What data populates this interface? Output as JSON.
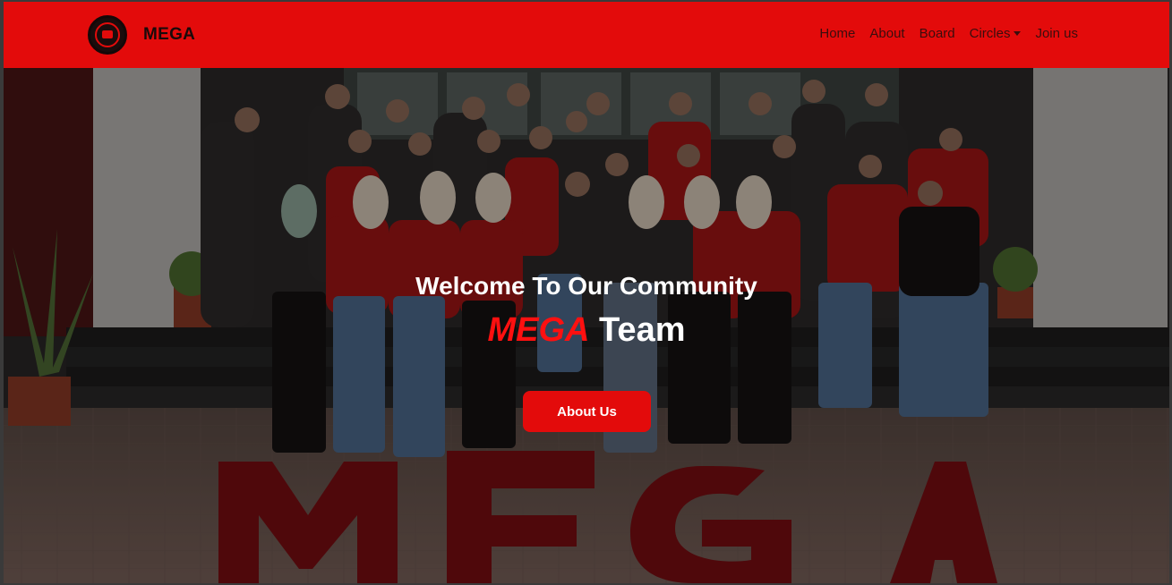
{
  "brand": {
    "name": "MEGA"
  },
  "nav": {
    "items": [
      {
        "label": "Home"
      },
      {
        "label": "About"
      },
      {
        "label": "Board"
      },
      {
        "label": "Circles",
        "dropdown": true
      },
      {
        "label": "Join us"
      }
    ]
  },
  "hero": {
    "welcome": "Welcome To Our Community",
    "team_highlight": "MEGA",
    "team_suffix": " Team",
    "button_label": "About Us"
  },
  "colors": {
    "accent": "#e30b0b",
    "highlight_text": "#ff1010",
    "hero_text": "#ffffff"
  },
  "icons": {
    "logo": "mega-logo-icon",
    "dropdown": "chevron-down-icon"
  }
}
